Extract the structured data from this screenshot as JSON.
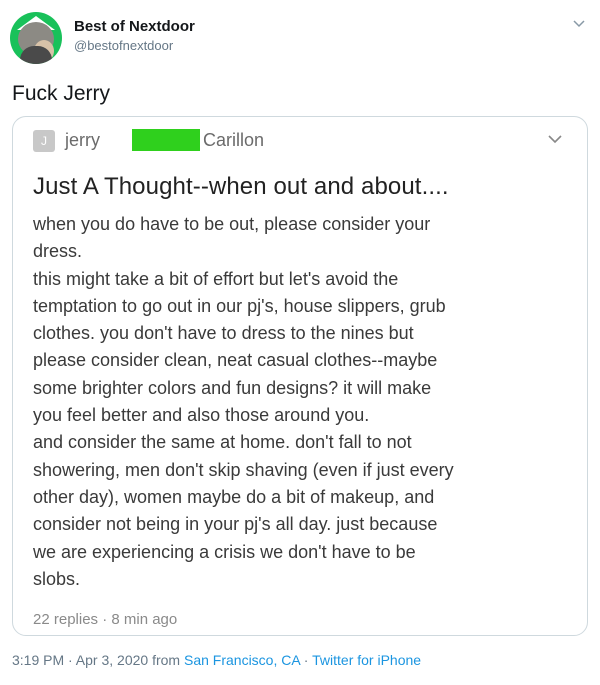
{
  "tweet": {
    "display_name": "Best of Nextdoor",
    "handle": "@bestofnextdoor",
    "text": "Fuck Jerry"
  },
  "card": {
    "avatar_letter": "J",
    "author_first": "jerry",
    "author_last": "Carillon",
    "title": "Just A Thought--when out and about....",
    "body": [
      "when you do have to be out, please consider your",
      "dress.",
      "this might take a bit of effort but let's avoid the",
      "temptation to go out in our pj's, house slippers, grub",
      "clothes.  you don't have to dress to the nines but",
      "please consider clean, neat casual clothes--maybe",
      "some brighter colors and fun designs?  it will make",
      "you feel better and also those around you.",
      "and consider the same at home.  don't fall to not",
      "showering, men don't skip shaving (even if just every",
      "other day), women maybe do a bit of makeup, and",
      "consider not being in your pj's all day. just because",
      "we are experiencing a crisis we don't have to be",
      "slobs."
    ],
    "meta": "22 replies · 8 min ago",
    "redaction_color": "#2fd01d"
  },
  "footer": {
    "time": "3:19 PM · Apr 3, 2020 from ",
    "location": "San Francisco, CA",
    "separator": " · ",
    "source": "Twitter for iPhone"
  },
  "icons": {
    "tweet_menu": "chevron-down-icon",
    "card_menu": "chevron-down-icon"
  }
}
